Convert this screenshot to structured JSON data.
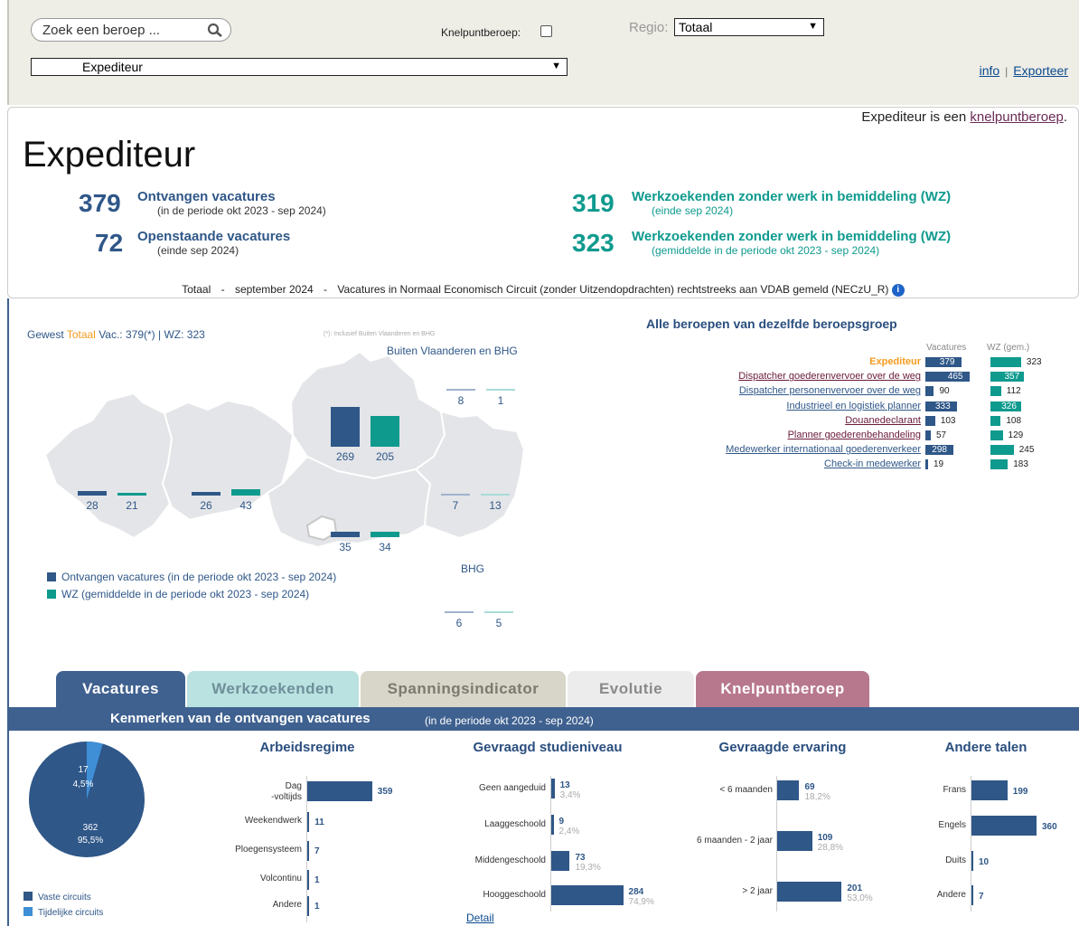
{
  "topbar": {
    "search_placeholder": "Zoek een beroep ...",
    "knelpunt_label": "Knelpuntberoep:",
    "regio_label": "Regio:",
    "regio_value": "Totaal",
    "beroep_value": "Expediteur",
    "info_link": "info",
    "separator": "|",
    "export_link": "Exporteer"
  },
  "summary": {
    "kp_text": "Expediteur is een",
    "kp_link": "knelpuntberoep",
    "kp_dot": ".",
    "title": "Expediteur",
    "s1_num": "379",
    "s1_head": "Ontvangen vacatures",
    "s1_sub": "(in de periode okt 2023 - sep 2024)",
    "s2_num": "72",
    "s2_head": "Openstaande vacatures",
    "s2_sub": "(einde sep 2024)",
    "s3_num": "319",
    "s3_head": "Werkzoekenden zonder werk in bemiddeling (WZ)",
    "s3_sub": "(einde sep 2024)",
    "s4_num": "323",
    "s4_head": "Werkzoekenden zonder werk in bemiddeling (WZ)",
    "s4_sub": "(gemiddelde in de periode okt 2023 - sep 2024)",
    "footer_1": "Totaal",
    "footer_dash": "-",
    "footer_2": "september 2024",
    "footer_3": "Vacatures in Normaal Economisch Circuit (zonder Uitzendopdrachten) rechtstreeks aan VDAB gemeld (NECzU_R)",
    "info_icon": "i"
  },
  "map": {
    "gewest_prefix": "Gewest",
    "gewest_name": "Totaal",
    "gewest_rest": "Vac.: 379(*) | WZ: 323",
    "note": "(*): Inclusief Buiten Vlaanderen en BHG",
    "buiten_label": "Buiten Vlaanderen en BHG",
    "bhg_label": "BHG",
    "legend_vac": "Ontvangen vacatures (in de periode okt 2023 - sep 2024)",
    "legend_wz": "WZ (gemiddelde in de periode okt 2023 - sep 2024)",
    "regions": [
      {
        "name": "West-Vlaanderen",
        "vac": 28,
        "wz": 21
      },
      {
        "name": "Oost-Vlaanderen",
        "vac": 26,
        "wz": 43
      },
      {
        "name": "Antwerpen",
        "vac": 269,
        "wz": 205
      },
      {
        "name": "Vlaams-Brabant",
        "vac": 35,
        "wz": 34
      },
      {
        "name": "Limburg",
        "vac": 7,
        "wz": 13
      },
      {
        "name": "Buiten Vlaanderen en BHG",
        "vac": 8,
        "wz": 1
      },
      {
        "name": "BHG",
        "vac": 6,
        "wz": 5
      }
    ]
  },
  "group": {
    "title": "Alle beroepen van dezelfde beroepsgroep",
    "col_vac": "Vacatures",
    "col_wz": "WZ (gem.)",
    "items": [
      {
        "label": "Expediteur",
        "vac": 379,
        "wz": 323
      },
      {
        "label": "Dispatcher goederenvervoer over de weg",
        "vac": 465,
        "wz": 357
      },
      {
        "label": "Dispatcher personenvervoer over de weg",
        "vac": 90,
        "wz": 112
      },
      {
        "label": "Industrieel en logistiek planner",
        "vac": 333,
        "wz": 326
      },
      {
        "label": "Douanedeclarant",
        "vac": 103,
        "wz": 108
      },
      {
        "label": "Planner goederenbehandeling",
        "vac": 57,
        "wz": 129
      },
      {
        "label": "Medewerker internationaal goederenverkeer",
        "vac": 298,
        "wz": 245
      },
      {
        "label": "Check-in medewerker",
        "vac": 19,
        "wz": 183
      }
    ]
  },
  "tabs": [
    "Vacatures",
    "Werkzoekenden",
    "Spanningsindicator",
    "Evolutie",
    "Knelpuntberoep"
  ],
  "strip": {
    "title": "Kenmerken van de ontvangen vacatures",
    "sub": "(in de periode okt 2023 - sep 2024)"
  },
  "pie": {
    "slices": [
      {
        "label": "Vaste circuits",
        "value": 362,
        "pct": "95,5%"
      },
      {
        "label": "Tijdelijke circuits",
        "value": 17,
        "pct": "4,5%"
      }
    ]
  },
  "arbeid": {
    "title": "Arbeidsregime",
    "rows": [
      {
        "l1": "Dag",
        "l2": "-voltijds",
        "v": 359
      },
      {
        "l1": "Weekendwerk",
        "l2": "",
        "v": 11
      },
      {
        "l1": "Ploegensysteem",
        "l2": "",
        "v": 7
      },
      {
        "l1": "Volcontinu",
        "l2": "",
        "v": 1
      },
      {
        "l1": "Andere",
        "l2": "",
        "v": 1
      }
    ]
  },
  "studie": {
    "title": "Gevraagd studieniveau",
    "rows": [
      {
        "l": "Geen aangeduid",
        "v": 13,
        "p": "3,4%"
      },
      {
        "l": "Laaggeschoold",
        "v": 9,
        "p": "2,4%"
      },
      {
        "l": "Middengeschoold",
        "v": 73,
        "p": "19,3%"
      },
      {
        "l": "Hooggeschoold",
        "v": 284,
        "p": "74,9%"
      }
    ],
    "detail": "Detail"
  },
  "ervaring": {
    "title": "Gevraagde ervaring",
    "rows": [
      {
        "l": "< 6 maanden",
        "v": 69,
        "p": "18,2%"
      },
      {
        "l": "6 maanden - 2 jaar",
        "v": 109,
        "p": "28,8%"
      },
      {
        "l": "> 2 jaar",
        "v": 201,
        "p": "53,0%"
      }
    ]
  },
  "talen": {
    "title": "Andere talen",
    "rows": [
      {
        "l": "Frans",
        "v": 199
      },
      {
        "l": "Engels",
        "v": 360
      },
      {
        "l": "Duits",
        "v": 10
      },
      {
        "l": "Andere",
        "v": 7
      }
    ]
  },
  "colors": {
    "vac": "#2f5788",
    "wz": "#0f9a8e",
    "accent": "#f39a1e"
  }
}
